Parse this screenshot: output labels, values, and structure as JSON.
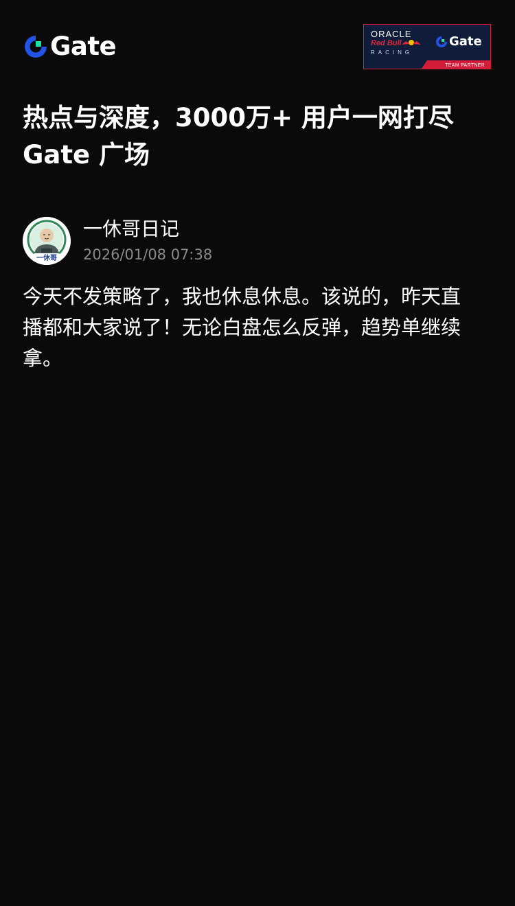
{
  "header": {
    "brand": {
      "wordmark": "Gate",
      "icon": "gate-logo-icon",
      "colors": {
        "blue": "#2354e6",
        "green": "#17e5a1"
      }
    },
    "partner_banner": {
      "oracle_text": "ORACLE",
      "redbull_text": "Red Bull",
      "racing_text": "RACING",
      "gate_text": "Gate",
      "partner_text": "TEAM PARTNER",
      "colors": {
        "background": "#0f1d3a",
        "accent": "#d31d3a"
      }
    }
  },
  "headline": {
    "line1": "热点与深度，3000万+ 用户一网打尽",
    "line2": "Gate 广场"
  },
  "post": {
    "author": {
      "name": "一休哥日记",
      "avatar_label": "一休哥",
      "avatar_icon": "monk-avatar-icon"
    },
    "timestamp": "2026/01/08 07:38",
    "body_lines": [
      "今天不发策略了，我也休息休息。该说的，昨天直",
      "播都和大家说了！无论白盘怎么反弹，趋势单继续",
      "拿。"
    ]
  },
  "colors": {
    "page_background": "#0a0a0a",
    "text_primary": "#ffffff",
    "text_secondary": "#8a8a8a"
  }
}
